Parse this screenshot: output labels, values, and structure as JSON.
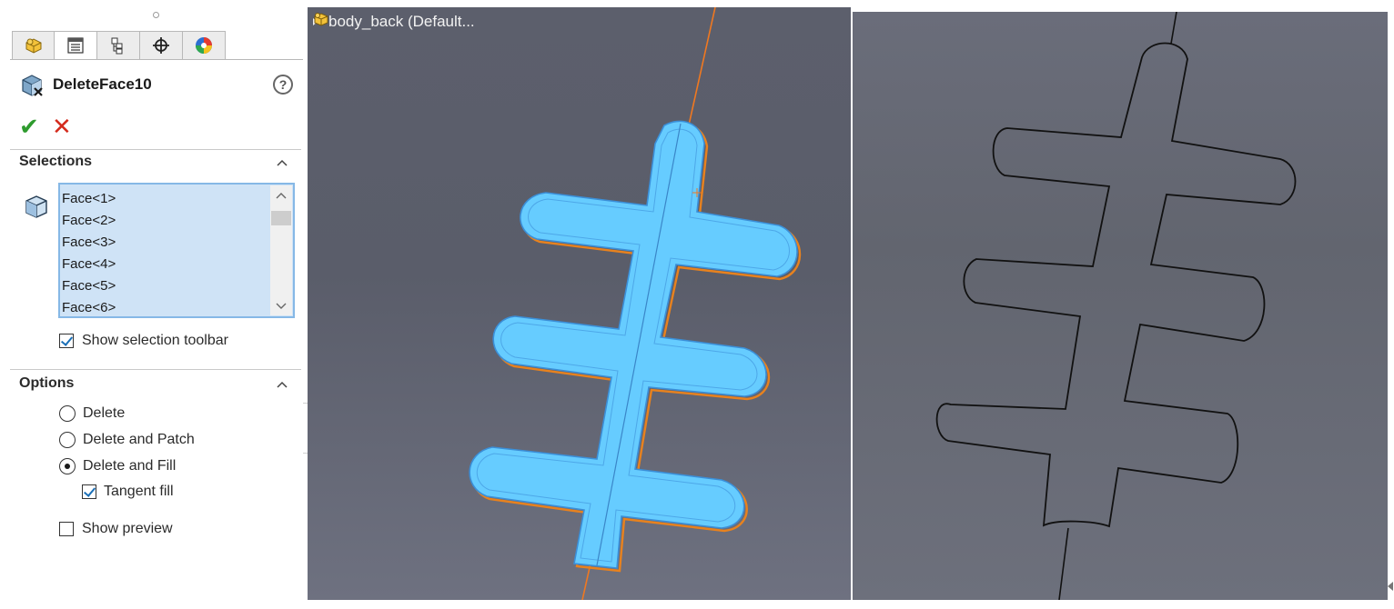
{
  "property_manager": {
    "tabs": [
      {
        "name": "feature-manager-tab",
        "icon": "part-tree-icon"
      },
      {
        "name": "property-manager-tab",
        "icon": "property-sheet-icon",
        "active": true
      },
      {
        "name": "configuration-manager-tab",
        "icon": "configuration-icon"
      },
      {
        "name": "dimxpert-manager-tab",
        "icon": "crosshair-icon"
      },
      {
        "name": "display-manager-tab",
        "icon": "appearance-sphere-icon"
      }
    ],
    "title": "DeleteFace10",
    "help_icon": "help-question-icon",
    "ok_icon": "green-check-icon",
    "cancel_icon": "red-x-icon",
    "selections": {
      "title": "Selections",
      "items": [
        "Face<1>",
        "Face<2>",
        "Face<3>",
        "Face<4>",
        "Face<5>",
        "Face<6>"
      ],
      "show_selection_toolbar_label": "Show selection toolbar",
      "show_selection_toolbar_checked": true
    },
    "options": {
      "title": "Options",
      "delete_label": "Delete",
      "delete_and_patch_label": "Delete and Patch",
      "delete_and_fill_label": "Delete and Fill",
      "selected": "Delete and Fill",
      "tangent_fill_label": "Tangent fill",
      "tangent_fill_checked": true,
      "show_preview_label": "Show preview",
      "show_preview_checked": false
    }
  },
  "viewport_left": {
    "tree_label": "body_back  (Default...",
    "highlight_color": "#66ccff",
    "edge_color": "#e8821e",
    "axis_color": "#f07820"
  },
  "viewport_right": {
    "outline_color": "#111111"
  }
}
